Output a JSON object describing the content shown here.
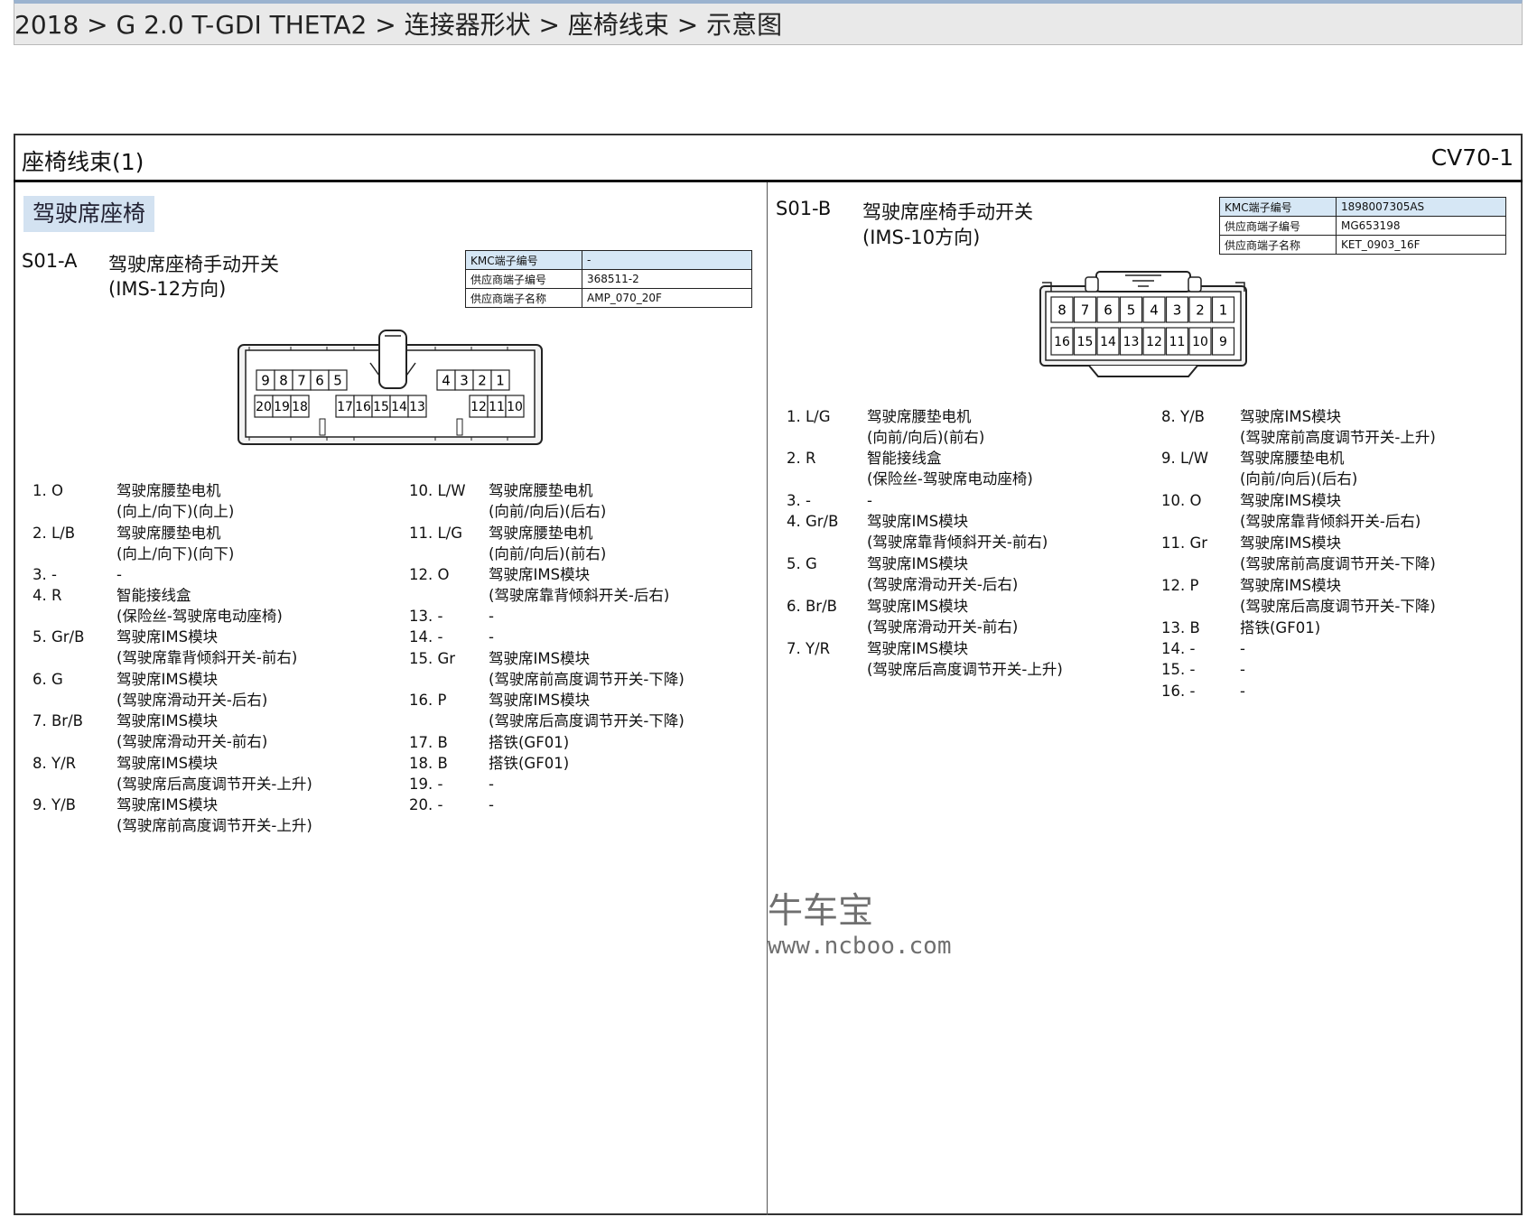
{
  "breadcrumb": "2018 > G 2.0 T-GDI THETA2 > 连接器形状 > 座椅线束 > 示意图",
  "sheet": {
    "title": "座椅线束(1)",
    "code": "CV70-1"
  },
  "section": "驾驶席座椅",
  "labels": {
    "kmc": "KMC端子编号",
    "sup_no": "供应商端子编号",
    "sup_name": "供应商端子名称"
  },
  "left": {
    "id": "S01-A",
    "name": "驾驶席座椅手动开关",
    "sub": "(IMS-12方向)",
    "kmc": "-",
    "sup_no": "368511-2",
    "sup_name": "AMP_070_20F",
    "top_pins": [
      "9",
      "8",
      "7",
      "6",
      "5",
      "4",
      "3",
      "2",
      "1"
    ],
    "bottom_pins": [
      "20",
      "19",
      "18",
      "17",
      "16",
      "15",
      "14",
      "13",
      "12",
      "11",
      "10"
    ],
    "pins": [
      {
        "n": "1. O",
        "d": "驾驶席腰垫电机",
        "d2": "(向上/向下)(向上)"
      },
      {
        "n": "2. L/B",
        "d": "驾驶席腰垫电机",
        "d2": "(向上/向下)(向下)"
      },
      {
        "n": "3. -",
        "d": "-",
        "d2": ""
      },
      {
        "n": "4. R",
        "d": "智能接线盒",
        "d2": "(保险丝-驾驶席电动座椅)"
      },
      {
        "n": "5. Gr/B",
        "d": "驾驶席IMS模块",
        "d2": "(驾驶席靠背倾斜开关-前右)"
      },
      {
        "n": "6. G",
        "d": "驾驶席IMS模块",
        "d2": "(驾驶席滑动开关-后右)"
      },
      {
        "n": "7. Br/B",
        "d": "驾驶席IMS模块",
        "d2": "(驾驶席滑动开关-前右)"
      },
      {
        "n": "8. Y/R",
        "d": "驾驶席IMS模块",
        "d2": "(驾驶席后高度调节开关-上升)"
      },
      {
        "n": "9. Y/B",
        "d": "驾驶席IMS模块",
        "d2": "(驾驶席前高度调节开关-上升)"
      },
      {
        "n": "10. L/W",
        "d": "驾驶席腰垫电机",
        "d2": "(向前/向后)(后右)"
      },
      {
        "n": "11. L/G",
        "d": "驾驶席腰垫电机",
        "d2": "(向前/向后)(前右)"
      },
      {
        "n": "12. O",
        "d": "驾驶席IMS模块",
        "d2": "(驾驶席靠背倾斜开关-后右)"
      },
      {
        "n": "13. -",
        "d": "-",
        "d2": ""
      },
      {
        "n": "14. -",
        "d": "-",
        "d2": ""
      },
      {
        "n": "15. Gr",
        "d": "驾驶席IMS模块",
        "d2": "(驾驶席前高度调节开关-下降)"
      },
      {
        "n": "16. P",
        "d": "驾驶席IMS模块",
        "d2": "(驾驶席后高度调节开关-下降)"
      },
      {
        "n": "17. B",
        "d": "搭铁(GF01)",
        "d2": ""
      },
      {
        "n": "18. B",
        "d": "搭铁(GF01)",
        "d2": ""
      },
      {
        "n": "19. -",
        "d": "-",
        "d2": ""
      },
      {
        "n": "20. -",
        "d": "-",
        "d2": ""
      }
    ]
  },
  "right": {
    "id": "S01-B",
    "name": "驾驶席座椅手动开关",
    "sub": "(IMS-10方向)",
    "kmc": "1898007305AS",
    "sup_no": "MG653198",
    "sup_name": "KET_0903_16F",
    "top_pins": [
      "8",
      "7",
      "6",
      "5",
      "4",
      "3",
      "2",
      "1"
    ],
    "bottom_pins": [
      "16",
      "15",
      "14",
      "13",
      "12",
      "11",
      "10",
      "9"
    ],
    "pins": [
      {
        "n": "1. L/G",
        "d": "驾驶席腰垫电机",
        "d2": "(向前/向后)(前右)"
      },
      {
        "n": "2. R",
        "d": "智能接线盒",
        "d2": "(保险丝-驾驶席电动座椅)"
      },
      {
        "n": "3. -",
        "d": "-",
        "d2": ""
      },
      {
        "n": "4. Gr/B",
        "d": "驾驶席IMS模块",
        "d2": "(驾驶席靠背倾斜开关-前右)"
      },
      {
        "n": "5. G",
        "d": "驾驶席IMS模块",
        "d2": "(驾驶席滑动开关-后右)"
      },
      {
        "n": "6. Br/B",
        "d": "驾驶席IMS模块",
        "d2": "(驾驶席滑动开关-前右)"
      },
      {
        "n": "7. Y/R",
        "d": "驾驶席IMS模块",
        "d2": "(驾驶席后高度调节开关-上升)"
      },
      {
        "n": "8. Y/B",
        "d": "驾驶席IMS模块",
        "d2": "(驾驶席前高度调节开关-上升)"
      },
      {
        "n": "9. L/W",
        "d": "驾驶席腰垫电机",
        "d2": "(向前/向后)(后右)"
      },
      {
        "n": "10. O",
        "d": "驾驶席IMS模块",
        "d2": "(驾驶席靠背倾斜开关-后右)"
      },
      {
        "n": "11. Gr",
        "d": "驾驶席IMS模块",
        "d2": "(驾驶席前高度调节开关-下降)"
      },
      {
        "n": "12. P",
        "d": "驾驶席IMS模块",
        "d2": "(驾驶席后高度调节开关-下降)"
      },
      {
        "n": "13. B",
        "d": "搭铁(GF01)",
        "d2": ""
      },
      {
        "n": "14. -",
        "d": "-",
        "d2": ""
      },
      {
        "n": "15. -",
        "d": "-",
        "d2": ""
      },
      {
        "n": "16. -",
        "d": "-",
        "d2": ""
      }
    ]
  },
  "watermark": {
    "logo": "牛车宝",
    "url": "www.ncboo.com"
  }
}
